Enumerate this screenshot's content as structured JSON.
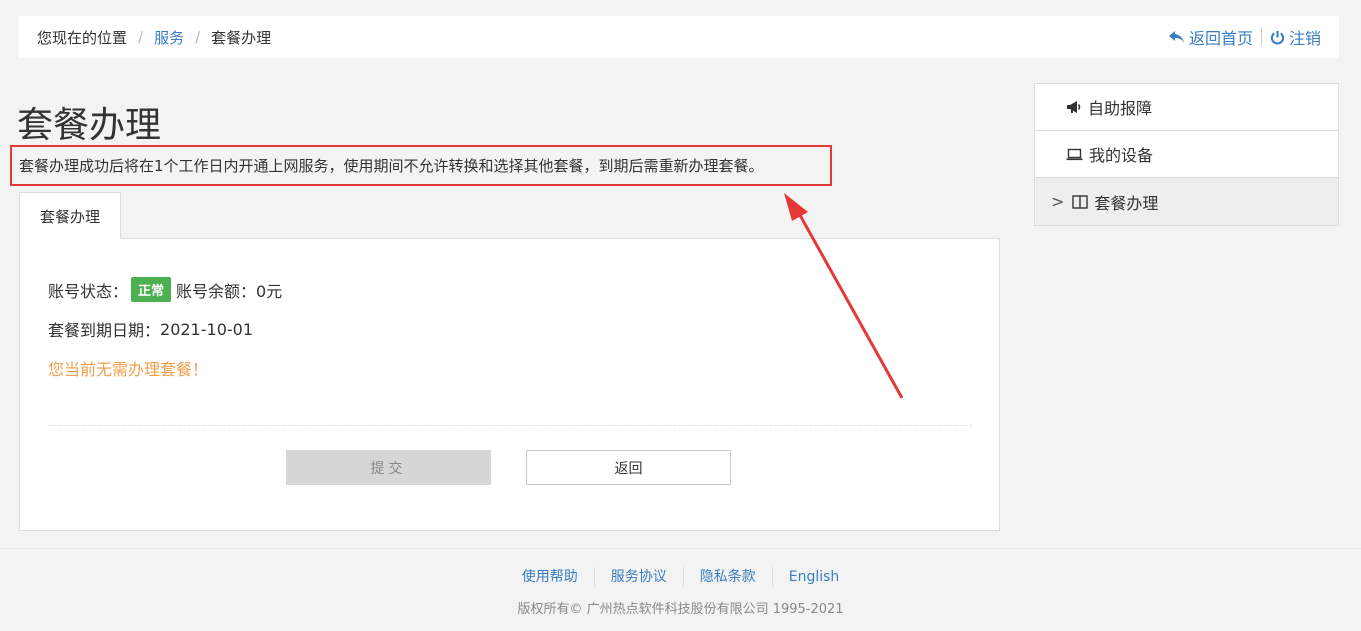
{
  "breadcrumb": {
    "prefix": "您现在的位置",
    "level1": "服务",
    "level2": "套餐办理",
    "separator": "/"
  },
  "top_links": {
    "home": "返回首页",
    "logout": "注销"
  },
  "page": {
    "title": "套餐办理",
    "notice": "套餐办理成功后将在1个工作日内开通上网服务，使用期间不允许转换和选择其他套餐，到期后需重新办理套餐。"
  },
  "tab": {
    "label": "套餐办理"
  },
  "account": {
    "status_label": "账号状态：",
    "status_value": "正常",
    "balance_label": "账号余额：",
    "balance_value": "0元",
    "expiry_label": "套餐到期日期：",
    "expiry_value": "2021-10-01",
    "message": "您当前无需办理套餐！"
  },
  "buttons": {
    "submit": "提交",
    "back": "返回"
  },
  "sidebar": {
    "items": [
      {
        "label": "自助报障",
        "icon": "megaphone-icon"
      },
      {
        "label": "我的设备",
        "icon": "laptop-icon"
      },
      {
        "label": "套餐办理",
        "icon": "book-icon",
        "active_marker": ">"
      }
    ]
  },
  "footer": {
    "links": [
      "使用帮助",
      "服务协议",
      "隐私条款",
      "English"
    ],
    "copyright": "版权所有© 广州热点软件科技股份有限公司 1995-2021"
  },
  "colors": {
    "link": "#3a7ec2",
    "badge": "#4caf50",
    "warning": "#f0a14e",
    "highlight": "#e53935"
  }
}
